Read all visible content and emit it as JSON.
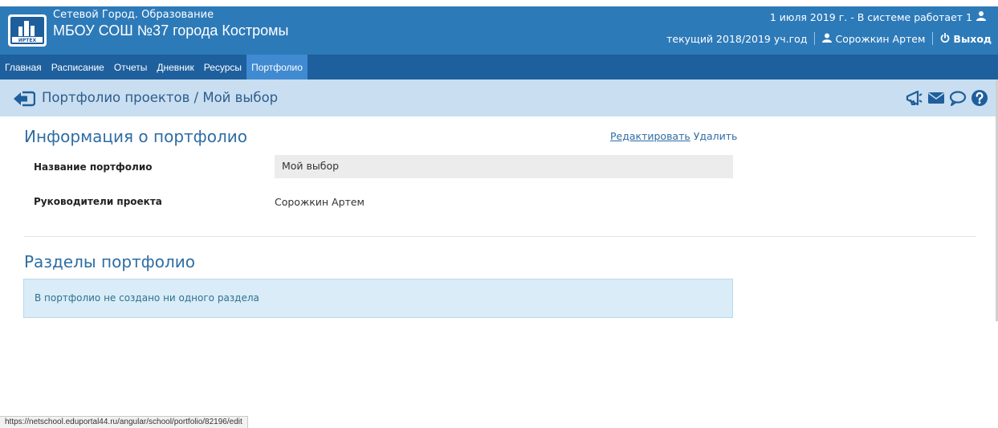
{
  "header": {
    "logo_text": "ИРТЕХ",
    "brand_subtitle": "Сетевой Город. Образование",
    "brand_title": "МБОУ СОШ №37 города Костромы",
    "date_status": "1 июля 2019 г. - В системе работает 1",
    "school_year": "текущий 2018/2019 уч.год",
    "user_name": "Сорожкин Артем",
    "logout_label": "Выход",
    "icons": [
      "online-users-icon",
      "user-icon",
      "power-icon"
    ]
  },
  "nav": {
    "items": [
      {
        "label": "Главная"
      },
      {
        "label": "Расписание"
      },
      {
        "label": "Отчеты"
      },
      {
        "label": "Дневник"
      },
      {
        "label": "Ресурсы"
      },
      {
        "label": "Портфолио",
        "active": true
      }
    ]
  },
  "breadcrumb": {
    "text": "Портфолио проектов / Мой выбор",
    "icons": [
      "back-arrow-icon",
      "announcement-icon",
      "mail-icon",
      "chat-icon",
      "help-icon"
    ]
  },
  "info": {
    "title": "Информация о портфолио",
    "edit_label": "Редактировать",
    "delete_label": "Удалить",
    "name_label": "Название портфолио",
    "name_value": "Мой выбор",
    "leaders_label": "Руководители проекта",
    "leaders_value": "Сорожкин Артем"
  },
  "sections": {
    "title": "Разделы портфолио",
    "empty_message": "В портфолио не создано ни одного раздела"
  },
  "status_bar": {
    "url": "https://netschool.eduportal44.ru/angular/school/portfolio/82196/edit"
  },
  "colors": {
    "header_bg": "#2d7ab9",
    "nav_bg": "#1e5f9d",
    "nav_active_bg": "#3f8ad0",
    "breadcrumb_bg": "#c9def0",
    "title_color": "#2e6da4",
    "info_box_bg": "#d9ecf8"
  }
}
